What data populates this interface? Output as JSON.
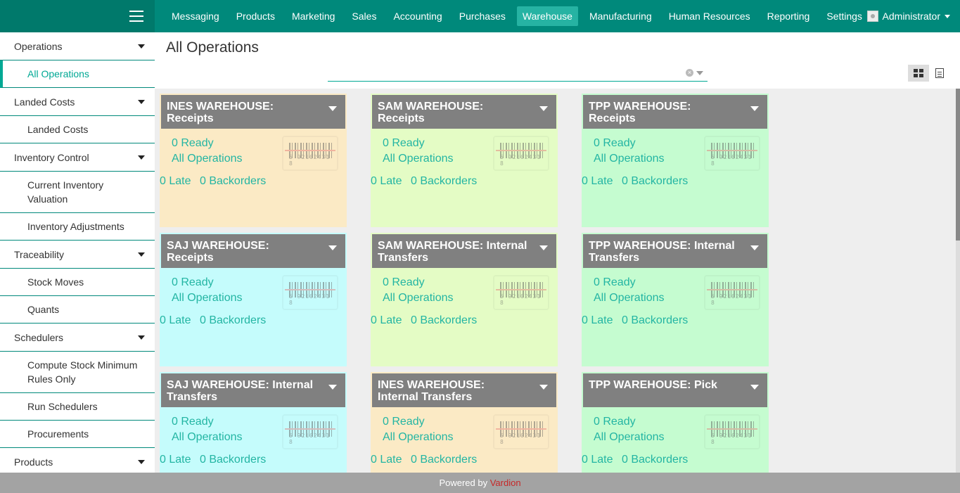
{
  "topnav": {
    "items": [
      "Messaging",
      "Products",
      "Marketing",
      "Sales",
      "Accounting",
      "Purchases",
      "Warehouse",
      "Manufacturing",
      "Human Resources",
      "Reporting",
      "Settings"
    ],
    "active": "Warehouse",
    "user": "Administrator"
  },
  "sidebar": {
    "sections": [
      {
        "label": "Operations",
        "items": [
          {
            "label": "All Operations",
            "active": true
          }
        ]
      },
      {
        "label": "Landed Costs",
        "items": [
          {
            "label": "Landed Costs"
          }
        ]
      },
      {
        "label": "Inventory Control",
        "items": [
          {
            "label": "Current Inventory Valuation"
          },
          {
            "label": "Inventory Adjustments"
          }
        ]
      },
      {
        "label": "Traceability",
        "items": [
          {
            "label": "Stock Moves"
          },
          {
            "label": "Quants"
          }
        ]
      },
      {
        "label": "Schedulers",
        "items": [
          {
            "label": "Compute Stock Minimum Rules Only"
          },
          {
            "label": "Run Schedulers"
          },
          {
            "label": "Procurements"
          }
        ]
      },
      {
        "label": "Products",
        "items": []
      }
    ]
  },
  "main": {
    "title": "All Operations",
    "search": {
      "value": "",
      "placeholder": ""
    }
  },
  "colors": {
    "topbar": "#00897b",
    "accent": "#00a894",
    "card_orange": "#fbeac5",
    "card_lime": "#e4fcc5",
    "card_green": "#c5fcd0",
    "card_cyan": "#c5fcfc"
  },
  "cards": [
    {
      "title": "INES WAREHOUSE: Receipts",
      "color": "#fbeac5",
      "ready": "0 Ready",
      "all": "All Operations",
      "late": "0 Late",
      "backorders": "0 Backorders",
      "barcode": "5 92102431 8"
    },
    {
      "title": "SAM WAREHOUSE: Receipts",
      "color": "#e4fcc5",
      "ready": "0 Ready",
      "all": "All Operations",
      "late": "0 Late",
      "backorders": "0 Backorders",
      "barcode": "5 92102431 8"
    },
    {
      "title": "TPP WAREHOUSE: Receipts",
      "color": "#c5fcd0",
      "ready": "0 Ready",
      "all": "All Operations",
      "late": "0 Late",
      "backorders": "0 Backorders",
      "barcode": "5 92102431 8"
    },
    {
      "title": "SAJ WAREHOUSE: Receipts",
      "color": "#c5fcfc",
      "ready": "0 Ready",
      "all": "All Operations",
      "late": "0 Late",
      "backorders": "0 Backorders",
      "barcode": "5 92102431 8"
    },
    {
      "title": "SAM WAREHOUSE: Internal Transfers",
      "color": "#e4fcc5",
      "ready": "0 Ready",
      "all": "All Operations",
      "late": "0 Late",
      "backorders": "0 Backorders",
      "barcode": "5 92102431 8"
    },
    {
      "title": "TPP WAREHOUSE: Internal Transfers",
      "color": "#c5fcd0",
      "ready": "0 Ready",
      "all": "All Operations",
      "late": "0 Late",
      "backorders": "0 Backorders",
      "barcode": "5 92102431 8"
    },
    {
      "title": "SAJ WAREHOUSE: Internal Transfers",
      "color": "#c5fcfc",
      "ready": "0 Ready",
      "all": "All Operations",
      "late": "0 Late",
      "backorders": "0 Backorders",
      "barcode": "5 92102431 8"
    },
    {
      "title": "INES WAREHOUSE: Internal Transfers",
      "color": "#fbeac5",
      "ready": "0 Ready",
      "all": "All Operations",
      "late": "0 Late",
      "backorders": "0 Backorders",
      "barcode": "5 92102431 8"
    },
    {
      "title": "TPP WAREHOUSE: Pick",
      "color": "#c5fcd0",
      "ready": "0 Ready",
      "all": "All Operations",
      "late": "0 Late",
      "backorders": "0 Backorders",
      "barcode": "5 92102431 8"
    }
  ],
  "footer": {
    "prefix": "Powered by",
    "brand": "Vardion"
  }
}
